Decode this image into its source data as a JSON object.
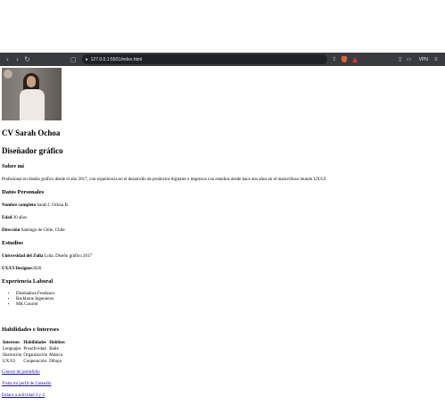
{
  "browser": {
    "url": "127.0.0.1:5501/index.html",
    "vpn_label": "VPN"
  },
  "cv": {
    "title": "CV Sarah Ochoa",
    "role": "Diseñador gráfico",
    "about_heading": "Sobre mí",
    "about_text": "Profesional en diseño gráfico desde el año 2017, con experiencia en el desarrollo de productos digitales e impresos con estudios desde hace dos años en el maravilloso mundo UX/UI",
    "personal_heading": "Datos Personales",
    "fullname_label": "Nombre completo",
    "fullname_value": "Sarah I. Ochoa B.",
    "age_label": "Edad",
    "age_value": "30 años",
    "address_label": "Dirección",
    "address_value": "Santiago de Chile, Chile",
    "studies_heading": "Estudios",
    "study1_label": "Universidad del Zulia",
    "study1_value": "Lcda. Diseño gráfico 2017",
    "study2_label": "UX/UI Designer",
    "study2_value": "2020",
    "experience_heading": "Experiencia Laboral",
    "experience_items": [
      "Diseñadora Freelance",
      "Backbone Ingenieros",
      "MK Courier"
    ],
    "skills_heading": "Habilidades e Intereses",
    "table_headers": [
      "Intereses",
      "Habilidades",
      "Hobbies"
    ],
    "table_rows": [
      [
        "Lenguajes",
        "Proactividad",
        "Baile"
      ],
      [
        "Ilustración",
        "Organización",
        "Música"
      ],
      [
        "UX/UI",
        "Cooperación",
        "Dibujo"
      ]
    ],
    "links": [
      "Conoce mi portafolio",
      "Visita mi perfil de Linkedin",
      "Enlace a actividad 3 y 4"
    ]
  }
}
